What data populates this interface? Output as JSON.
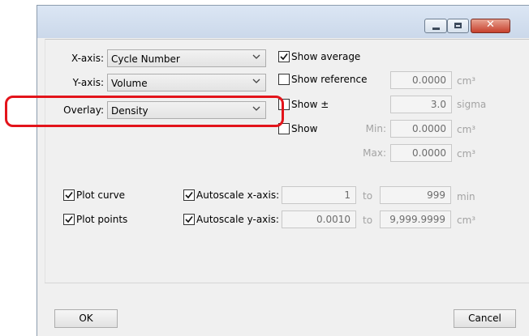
{
  "title_bar": {
    "minimize_glyph": "–",
    "maximize_glyph": "□",
    "close_glyph": "✕"
  },
  "axes": {
    "x_label": "X-axis:",
    "x_value": "Cycle Number",
    "y_label": "Y-axis:",
    "y_value": "Volume",
    "overlay_label": "Overlay:",
    "overlay_value": "Density"
  },
  "options": {
    "show_average": {
      "label": "Show average",
      "checked": true
    },
    "show_reference": {
      "label": "Show reference",
      "checked": false,
      "value": "0.0000",
      "unit": "cm³"
    },
    "show_pm": {
      "label": "Show ±",
      "checked": false,
      "value": "3.0",
      "unit": "sigma"
    },
    "show": {
      "label": "Show",
      "checked": false,
      "min_label": "Min:",
      "min_value": "0.0000",
      "min_unit": "cm³",
      "max_label": "Max:",
      "max_value": "0.0000",
      "max_unit": "cm³"
    }
  },
  "plot": {
    "plot_curve": {
      "label": "Plot curve",
      "checked": true
    },
    "plot_points": {
      "label": "Plot points",
      "checked": true
    },
    "autoscale_x": {
      "label": "Autoscale x-axis:",
      "checked": true,
      "from": "1",
      "to_label": "to",
      "to": "999",
      "unit": "min"
    },
    "autoscale_y": {
      "label": "Autoscale y-axis:",
      "checked": true,
      "from": "0.0010",
      "to_label": "to",
      "to": "9,999.9999",
      "unit": "cm³"
    }
  },
  "buttons": {
    "ok": "OK",
    "cancel": "Cancel"
  },
  "colors": {
    "highlight": "#e3141b",
    "window_bg": "#f0f0f0"
  }
}
